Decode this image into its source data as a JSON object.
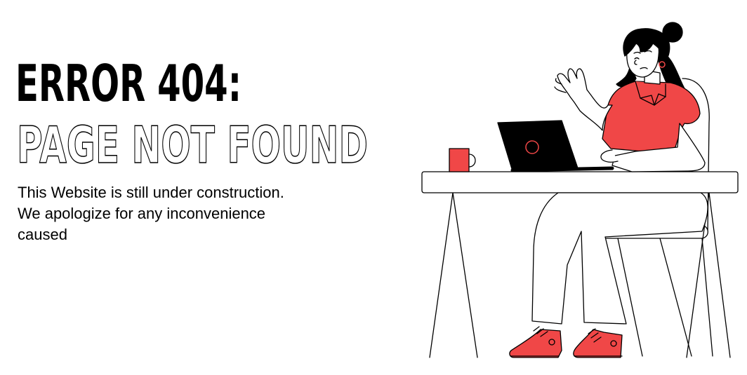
{
  "error": {
    "heading": "ERROR 404:",
    "subheading": "PAGE NOT FOUND",
    "message_lines": [
      "This Website is still under construction.",
      "We apologize for any inconvenience",
      "caused"
    ]
  },
  "colors": {
    "accent": "#f04747",
    "text": "#000000",
    "background": "#ffffff"
  }
}
